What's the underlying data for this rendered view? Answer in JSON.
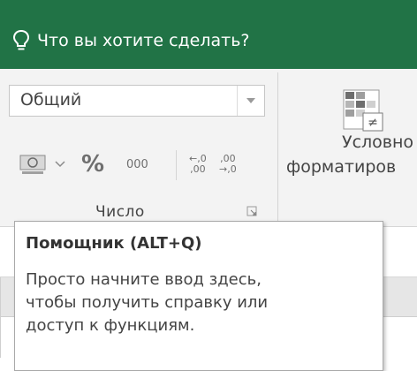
{
  "tell_me": {
    "text": "Что вы хотите сделать?",
    "icon": "lightbulb-icon"
  },
  "number_group": {
    "format_value": "Общий",
    "percent_label": "%",
    "comma_label": "000",
    "increase_decimal": {
      "top": "←,0",
      "bottom": ",00"
    },
    "decrease_decimal": {
      "top": ",00",
      "bottom": "→,0"
    },
    "group_label": "Число"
  },
  "conditional_formatting": {
    "line1": "Условно",
    "line2": "форматиров"
  },
  "tooltip": {
    "title": "Помощник (ALT+Q)",
    "lines": [
      "Просто начните ввод здесь,",
      "чтобы получить справку или",
      "доступ к функциям."
    ]
  },
  "colors": {
    "accent": "#217346",
    "ribbon_bg": "#f3f3f3"
  }
}
